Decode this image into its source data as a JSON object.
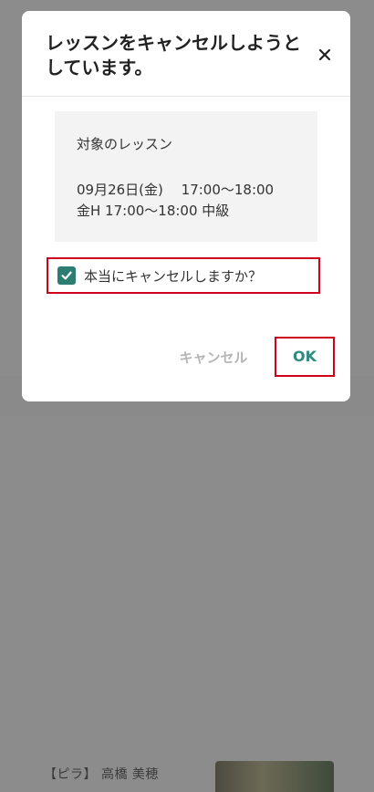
{
  "background": {
    "partial_text": "【ピラ】 高橋 美穂"
  },
  "dialog": {
    "title": "レッスンをキャンセルしようとしています。",
    "target_label": "対象のレッスン",
    "lesson_datetime": "09月26日(金)　 17:00〜18:00",
    "lesson_name": "金H 17:00〜18:00 中級",
    "confirm_label": "本当にキャンセルしますか？",
    "confirm_checked": true,
    "cancel_button": "キャンセル",
    "ok_button": "OK"
  },
  "colors": {
    "accent": "#2e8b80",
    "checkbox": "#2e7d73",
    "highlight_border": "#d0021b",
    "disabled_text": "#b5b5b5"
  }
}
